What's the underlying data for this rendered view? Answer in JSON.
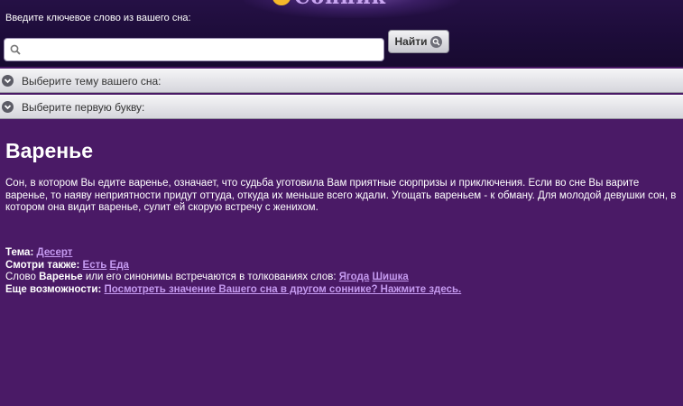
{
  "header": {
    "search_label": "Введите ключевое слово из вашего сна:",
    "search_value": "",
    "search_placeholder": "",
    "find_button": "Найти"
  },
  "accordions": [
    {
      "label": "Выберите тему вашего сна:"
    },
    {
      "label": "Выберите первую букву:"
    }
  ],
  "article": {
    "title": "Варенье",
    "text": "Сон, в котором Вы едите варенье, означает, что судьба уготовила Вам приятные сюрпризы и приключения. Если во сне Вы варите варенье, то наяву неприятности придут оттуда, откуда их меньше всего ждали. Угощать вареньем - к обману. Для молодой девушки сон, в котором она видит варенье, сулит ей скорую встречу с женихом."
  },
  "meta": {
    "theme_label": "Тема:",
    "theme_link": "Десерт",
    "see_also_label": "Смотри также:",
    "see_also_links": [
      "Есть",
      "Еда"
    ],
    "synonyms_prefix": "Слово",
    "synonyms_word": "Варенье",
    "synonyms_suffix": "или его синонимы встречаются в толкованиях слов:",
    "synonyms_links": [
      "Ягода",
      "Шишка"
    ],
    "more_label": "Еще возможности:",
    "more_link": "Посмотреть значение Вашего сна в другом соннике? Нажмите здесь."
  },
  "colors": {
    "background": "#4a1a66",
    "header": "#1c0c38",
    "link": "#c59af0"
  }
}
